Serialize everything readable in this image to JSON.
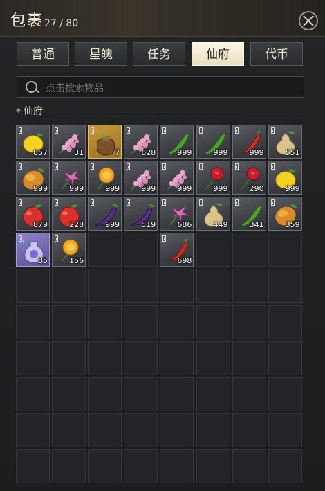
{
  "header": {
    "title": "包裹",
    "capacity": "27 / 80"
  },
  "tabs": [
    {
      "label": "普通",
      "active": false
    },
    {
      "label": "星魄",
      "active": false
    },
    {
      "label": "任务",
      "active": false
    },
    {
      "label": "仙府",
      "active": true
    },
    {
      "label": "代币",
      "active": false
    }
  ],
  "search": {
    "placeholder": "点击搜索物品"
  },
  "section": {
    "title": "仙府"
  },
  "grid": {
    "rows": 10,
    "cols": 8
  },
  "items": [
    {
      "icon": "lemon-icon",
      "qty": "857",
      "bg": "filled"
    },
    {
      "icon": "lily-of-valley-icon",
      "qty": "31",
      "bg": "filled"
    },
    {
      "icon": "treasure-bag-icon",
      "qty": "7",
      "bg": "gold"
    },
    {
      "icon": "lily-of-valley-icon",
      "qty": "628",
      "bg": "filled"
    },
    {
      "icon": "green-pepper-icon",
      "qty": "999",
      "bg": "filled"
    },
    {
      "icon": "green-pepper-icon",
      "qty": "999",
      "bg": "filled"
    },
    {
      "icon": "red-chili-icon",
      "qty": "999",
      "bg": "filled"
    },
    {
      "icon": "pear-icon",
      "qty": "551",
      "bg": "filled"
    },
    {
      "icon": "mango-icon",
      "qty": "999",
      "bg": "filled"
    },
    {
      "icon": "lily-flower-icon",
      "qty": "999",
      "bg": "filled"
    },
    {
      "icon": "marigold-icon",
      "qty": "999",
      "bg": "filled"
    },
    {
      "icon": "lily-of-valley-icon",
      "qty": "999",
      "bg": "filled"
    },
    {
      "icon": "lily-of-valley-icon",
      "qty": "999",
      "bg": "filled"
    },
    {
      "icon": "rose-icon",
      "qty": "999",
      "bg": "filled"
    },
    {
      "icon": "rose-icon",
      "qty": "290",
      "bg": "filled"
    },
    {
      "icon": "lemon-icon",
      "qty": "999",
      "bg": "filled"
    },
    {
      "icon": "apple-icon",
      "qty": "879",
      "bg": "filled"
    },
    {
      "icon": "apple-icon",
      "qty": "228",
      "bg": "filled"
    },
    {
      "icon": "eggplant-icon",
      "qty": "999",
      "bg": "filled"
    },
    {
      "icon": "eggplant-icon",
      "qty": "519",
      "bg": "filled"
    },
    {
      "icon": "lily-flower-icon",
      "qty": "686",
      "bg": "filled"
    },
    {
      "icon": "pear-icon",
      "qty": "449",
      "bg": "filled"
    },
    {
      "icon": "green-pepper-icon",
      "qty": "341",
      "bg": "filled"
    },
    {
      "icon": "mango-icon",
      "qty": "359",
      "bg": "filled"
    },
    {
      "icon": "potion-vase-icon",
      "qty": "85",
      "bg": "purple"
    },
    {
      "icon": "marigold-icon",
      "qty": "156",
      "bg": "filled"
    },
    null,
    null,
    {
      "icon": "red-chili-icon",
      "qty": "698",
      "bg": "filled"
    }
  ],
  "colors": {
    "accent": "#efe5c8",
    "panel": "#1c1d1f",
    "slot": "#232427"
  }
}
